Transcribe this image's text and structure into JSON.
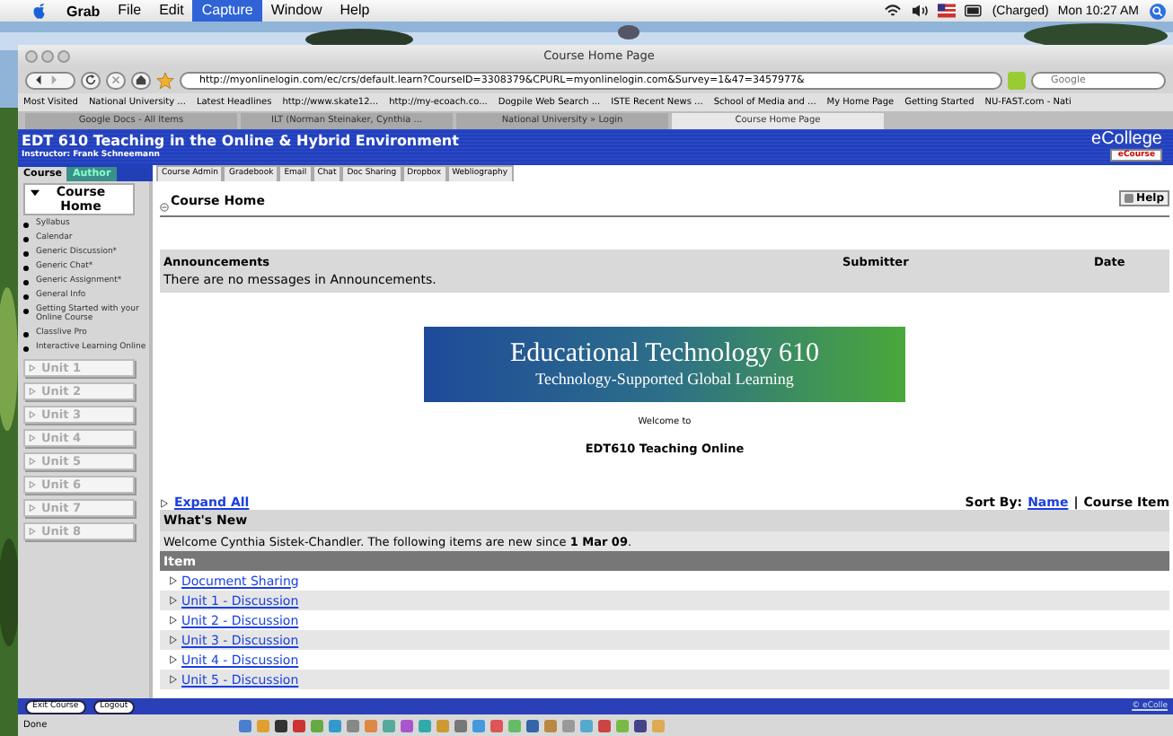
{
  "menubar": {
    "app": "Grab",
    "items": [
      {
        "label": "File",
        "selected": false
      },
      {
        "label": "Edit",
        "selected": false
      },
      {
        "label": "Capture",
        "selected": true
      },
      {
        "label": "Window",
        "selected": false
      },
      {
        "label": "Help",
        "selected": false
      }
    ],
    "battery": "(Charged)",
    "clock": "Mon 10:27 AM"
  },
  "browser": {
    "title": "Course Home Page",
    "url": "http://myonlinelogin.com/ec/crs/default.learn?CourseID=3308379&CPURL=myonlinelogin.com&Survey=1&47=3457977&",
    "search": {
      "placeholder": "Google"
    },
    "bookmarks": [
      "Most Visited",
      "National University ...",
      "Latest Headlines",
      "http://www.skate12...",
      "http://my-ecoach.co...",
      "Dogpile Web Search ...",
      "ISTE Recent News ...",
      "School of Media and ...",
      "My Home Page",
      "Getting Started",
      "NU-FAST.com - Nati"
    ],
    "tabs": [
      {
        "label": "Google Docs - All Items",
        "selected": false
      },
      {
        "label": "ILT (Norman Steinaker, Cynthia ...",
        "selected": false
      },
      {
        "label": "National University » Login",
        "selected": false
      },
      {
        "label": "Course Home Page",
        "selected": true
      }
    ],
    "status": "Done"
  },
  "page": {
    "course_title": "EDT 610 Teaching in the Online & Hybrid Environment",
    "instructor": "Instructor: Frank Schneemann",
    "logo": "eCollege",
    "logo_badge": "eCourse",
    "mode_tabs": [
      {
        "label": "Course",
        "selected": true
      },
      {
        "label": "Author",
        "selected": false
      }
    ],
    "tool_tabs": [
      "Course Admin",
      "Gradebook",
      "Email",
      "Chat",
      "Doc Sharing",
      "Dropbox",
      "Webliography"
    ],
    "sidebar": {
      "section": {
        "label": "Course Home",
        "expanded": true
      },
      "items": [
        "Syllabus",
        "Calendar",
        "Generic Discussion*",
        "Generic Chat*",
        "Generic Assignment*",
        "General Info",
        "Getting Started with your Online Course",
        "Classlive Pro",
        "Interactive Learning Online"
      ],
      "units": [
        "Unit 1",
        "Unit 2",
        "Unit 3",
        "Unit 4",
        "Unit 5",
        "Unit 6",
        "Unit 7",
        "Unit 8"
      ]
    },
    "heading": "Course Home",
    "help": "Help",
    "announcements": {
      "columns": [
        "Announcements",
        "Submitter",
        "Date"
      ],
      "message": "There are no messages in Announcements."
    },
    "banner": {
      "title": "Educational Technology 610",
      "subtitle": "Technology-Supported Global Learning"
    },
    "welcome": "Welcome to",
    "course_name": "EDT610 Teaching Online",
    "expand_all": "Expand All",
    "sort": {
      "label": "Sort By:",
      "link": "Name",
      "separator": "|",
      "current": "Course Item"
    },
    "whats_new": {
      "title": "What's New",
      "text": "Welcome Cynthia Sistek-Chandler. The following items are new since **1 Mar 09**.",
      "column": "Item",
      "items": [
        "Document Sharing",
        "Unit 1 - Discussion",
        "Unit 2 - Discussion",
        "Unit 3 - Discussion",
        "Unit 4 - Discussion",
        "Unit 5 - Discussion"
      ]
    },
    "footer": {
      "buttons": [
        "Exit Course",
        "Logout"
      ],
      "copyright": "© eColle"
    }
  }
}
